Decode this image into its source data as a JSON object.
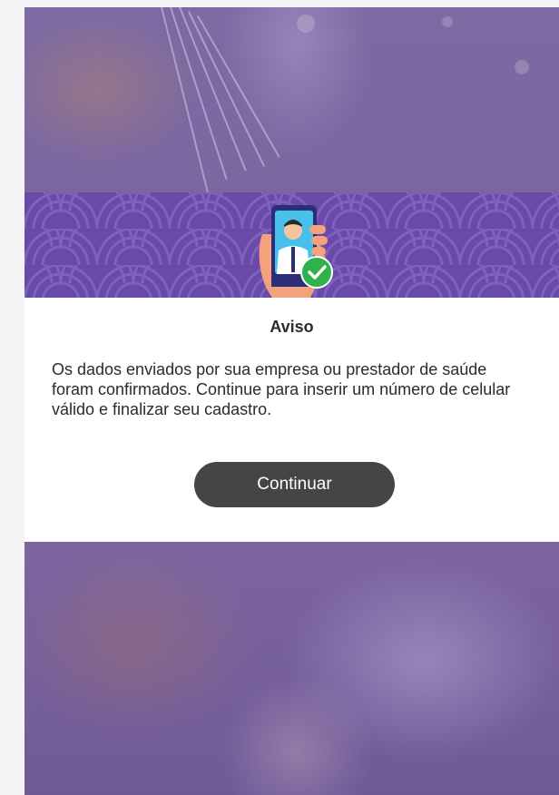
{
  "dialog": {
    "title": "Aviso",
    "message": "Os dados enviados por sua empresa ou prestador de saúde foram confirmados. Continue para inserir um número de celular válido e finalizar seu cadastro.",
    "continue_label": "Continuar"
  },
  "colors": {
    "banner": "#6a4aa8",
    "button": "#454545",
    "check": "#2fb24a",
    "overlay": "#7a649f"
  },
  "icons": {
    "illustration": "phone-confirmed-illustration",
    "check": "check-circle-icon"
  }
}
